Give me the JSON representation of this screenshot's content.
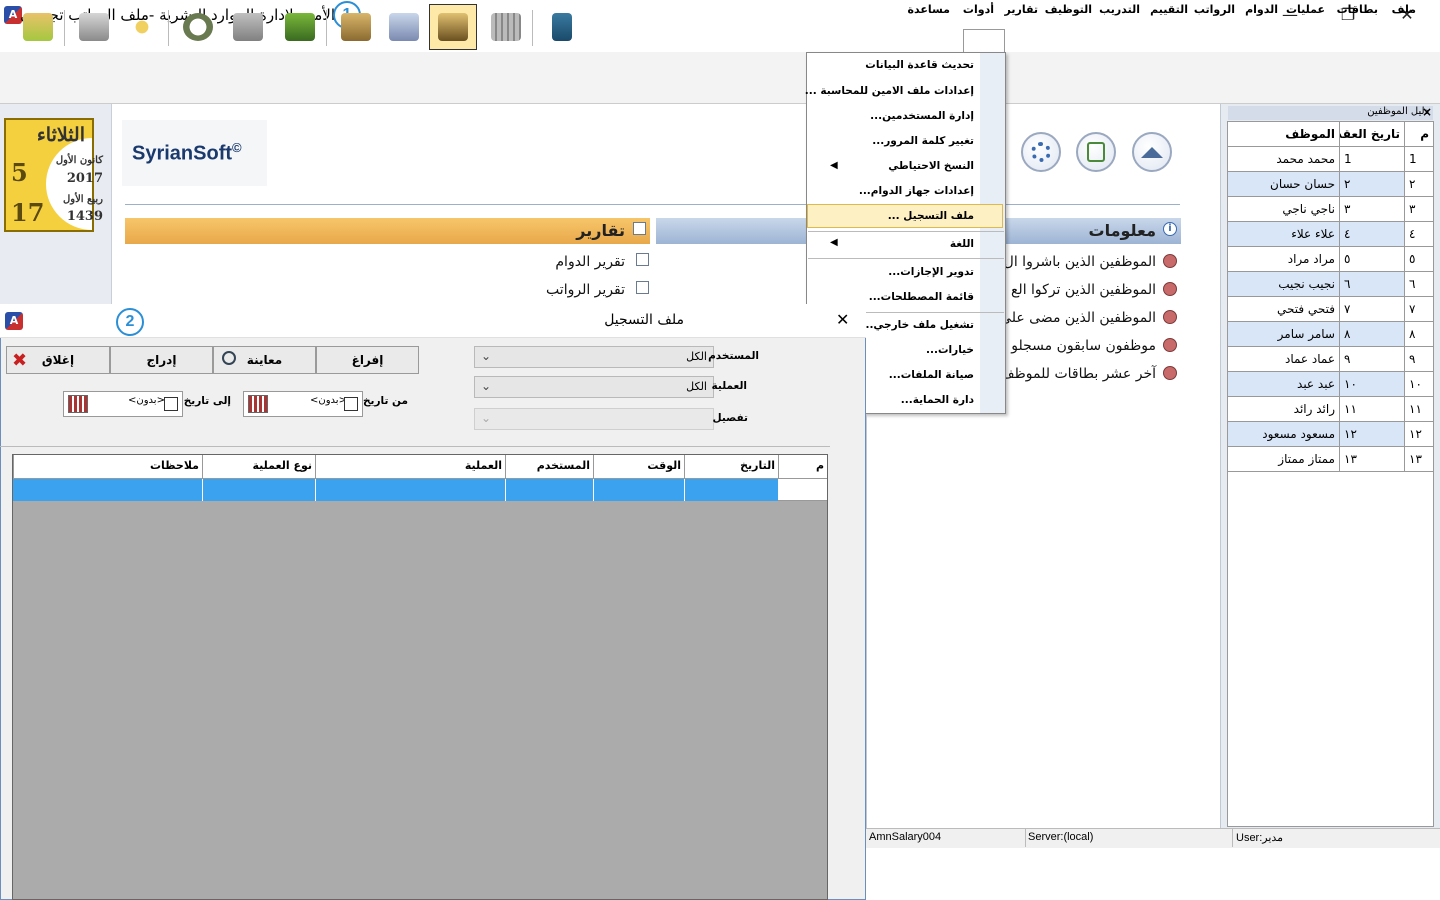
{
  "window": {
    "title": "الأمين لإدارة الموارد البشرية -ملف الرواتب تجريبي",
    "callout_1": "1",
    "callout_2": "2",
    "minimize": "—",
    "maximize": "❐",
    "close": "✕"
  },
  "menubar": {
    "items": [
      "ملف",
      "بطاقات",
      "عمليات",
      "الدوام",
      "الرواتب",
      "التقييم",
      "التدريب",
      "التوظيف",
      "تقارير",
      "أدوات",
      "مساعدة"
    ]
  },
  "calendar": {
    "day_name": "الثلاثاء",
    "greg_day": "5",
    "greg_month": "كانون الأول",
    "greg_year": "2017",
    "hijri_day": "17",
    "hijri_month": "ربيع الأول",
    "hijri_year": "1439"
  },
  "brand": {
    "logo": "SyrianSoft",
    "copyright": "©"
  },
  "reports": {
    "title": "تقارير",
    "links": [
      "تقرير الدوام",
      "تقرير الرواتب"
    ]
  },
  "info": {
    "title": "معلومات",
    "links": [
      "الموظفين الذين باشروا ال",
      "الموظفين الذين تركوا الع",
      "الموظفين الذين مضى على",
      "موظفون سابقون مسجلو",
      "آخر عشر بطاقات للموظف"
    ]
  },
  "tools_menu": {
    "items": [
      "تحديث قاعدة البيانات",
      "إعدادات ملف الامين للمحاسبة ...",
      "إدارة المستخدمين...",
      "تغيير كلمة المرور...",
      "النسخ الاحتياطي",
      "إعدادات جهاز الدوام...",
      "ملف التسجيل ...",
      "اللغة",
      "تدوير الإجازات...",
      "قائمة المصطلحات...",
      "تشغيل ملف خارجي...",
      "خيارات...",
      "صيانة الملفات...",
      "دارة الحماية..."
    ],
    "submenu_arrow": "◀"
  },
  "employees": {
    "title": "دليل الموظفين",
    "close": "×",
    "headers": {
      "num": "م",
      "date": "تاريخ العقد",
      "name": "الموظف"
    },
    "rows": [
      {
        "num": "1",
        "date": "1",
        "name": "محمد محمد"
      },
      {
        "num": "٢",
        "date": "٢",
        "name": "حسان حسان"
      },
      {
        "num": "٣",
        "date": "٣",
        "name": "ناجي ناجي"
      },
      {
        "num": "٤",
        "date": "٤",
        "name": "علاء علاء"
      },
      {
        "num": "٥",
        "date": "٥",
        "name": "مراد مراد"
      },
      {
        "num": "٦",
        "date": "٦",
        "name": "نجيب نجيب"
      },
      {
        "num": "٧",
        "date": "٧",
        "name": "فتحي فتحي"
      },
      {
        "num": "٨",
        "date": "٨",
        "name": "سامر سامر"
      },
      {
        "num": "٩",
        "date": "٩",
        "name": "عماد عماد"
      },
      {
        "num": "١٠",
        "date": "١٠",
        "name": "عبد عبد"
      },
      {
        "num": "١١",
        "date": "١١",
        "name": "رائد رائد"
      },
      {
        "num": "١٢",
        "date": "١٢",
        "name": "مسعود مسعود"
      },
      {
        "num": "١٣",
        "date": "١٣",
        "name": "ممتاز ممتاز"
      }
    ]
  },
  "statusbar": {
    "db": "AmnSalary004",
    "server": "Server:(local)",
    "user": "User:مدير"
  },
  "dialog": {
    "title": "ملف التسجيل",
    "close": "✕",
    "buttons": {
      "empty": "إفراغ",
      "preview": "معاينة",
      "insert": "إدراج",
      "close": "إغلاق"
    },
    "filters": {
      "user_label": "المستخدم",
      "user_value": "الكل",
      "op_label": "العملية",
      "op_value": "الكل",
      "detail_label": "تفصيل",
      "detail_value": "",
      "from_label": "من تاريخ",
      "from_value": "<بدون>",
      "to_label": "إلى تاريخ",
      "to_value": "<بدون>"
    },
    "grid_headers": [
      "م",
      "التاريخ",
      "الوقت",
      "المستخدم",
      "العملية",
      "نوع العملية",
      "ملاحظات"
    ]
  },
  "colors": {
    "accent": "#2a8fd6",
    "selection": "#3ba2f0",
    "calendar": "#f4d03f"
  }
}
